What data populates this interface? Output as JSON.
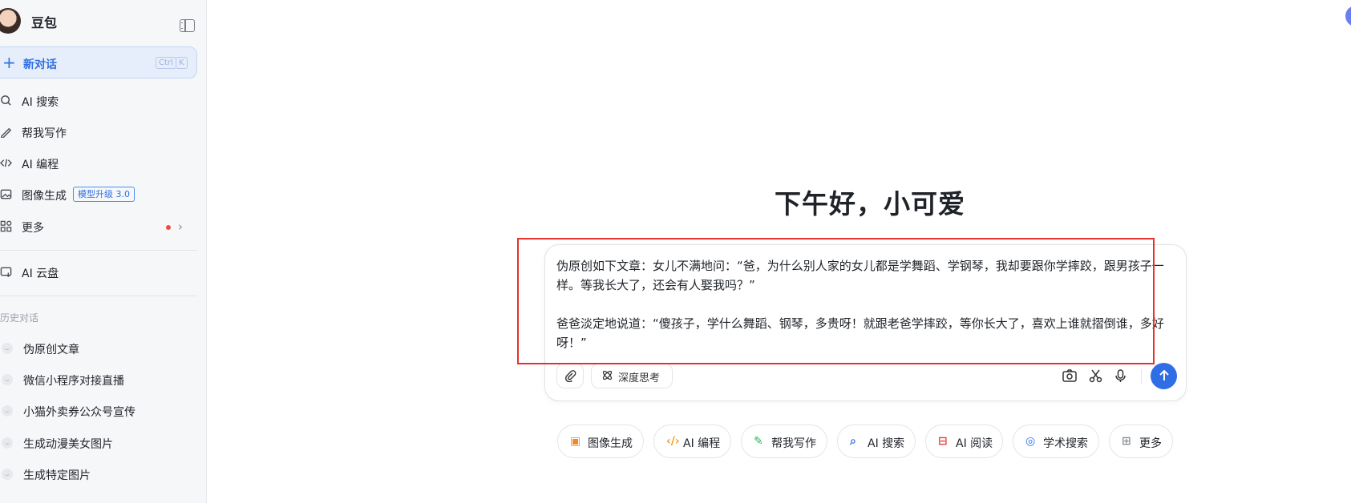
{
  "brand": {
    "name": "豆包"
  },
  "new_chat": {
    "label": "新对话",
    "shortcut_ctrl": "Ctrl",
    "shortcut_key": "K"
  },
  "nav": [
    {
      "label": "AI 搜索",
      "icon": "search-icon"
    },
    {
      "label": "帮我写作",
      "icon": "pen-icon"
    },
    {
      "label": "AI 编程",
      "icon": "code-icon"
    },
    {
      "label": "图像生成",
      "icon": "image-icon",
      "badge": "模型升级 3.0"
    },
    {
      "label": "更多",
      "icon": "apps-icon",
      "has_dot": true
    },
    {
      "label": "AI 云盘",
      "icon": "cloud-drive-icon"
    }
  ],
  "history": {
    "title": "历史对话",
    "items": [
      "伪原创文章",
      "微信小程序对接直播",
      "小猫外卖券公众号宣传",
      "生成动漫美女图片",
      "生成特定图片"
    ]
  },
  "main": {
    "greeting": "下午好，小可爱",
    "input_text": "伪原创如下文章：女儿不满地问：“爸，为什么别人家的女儿都是学舞蹈、学钢琴，我却要跟你学摔跤，跟男孩子一样。等我长大了，还会有人娶我吗？”\n\n爸爸淡定地说道：“傻孩子，学什么舞蹈、钢琴，多贵呀！就跟老爸学摔跤，等你长大了，喜欢上谁就摺倒谁，多好呀！”",
    "deep_think_label": "深度思考"
  },
  "chips": [
    {
      "label": "图像生成",
      "icon": "image-icon",
      "color": "#f08a24"
    },
    {
      "label": "AI 编程",
      "icon": "code-icon",
      "color": "#f0a020"
    },
    {
      "label": "帮我写作",
      "icon": "pen-icon",
      "color": "#2fb35e"
    },
    {
      "label": "AI 搜索",
      "icon": "search-icon",
      "color": "#2f6ee5"
    },
    {
      "label": "AI 阅读",
      "icon": "book-icon",
      "color": "#e5403a"
    },
    {
      "label": "学术搜索",
      "icon": "academic-icon",
      "color": "#2f6ee5"
    },
    {
      "label": "更多",
      "icon": "apps-icon",
      "color": "#8a8f96"
    }
  ],
  "colors": {
    "accent": "#2f6ee5",
    "highlight": "#e8312a"
  }
}
